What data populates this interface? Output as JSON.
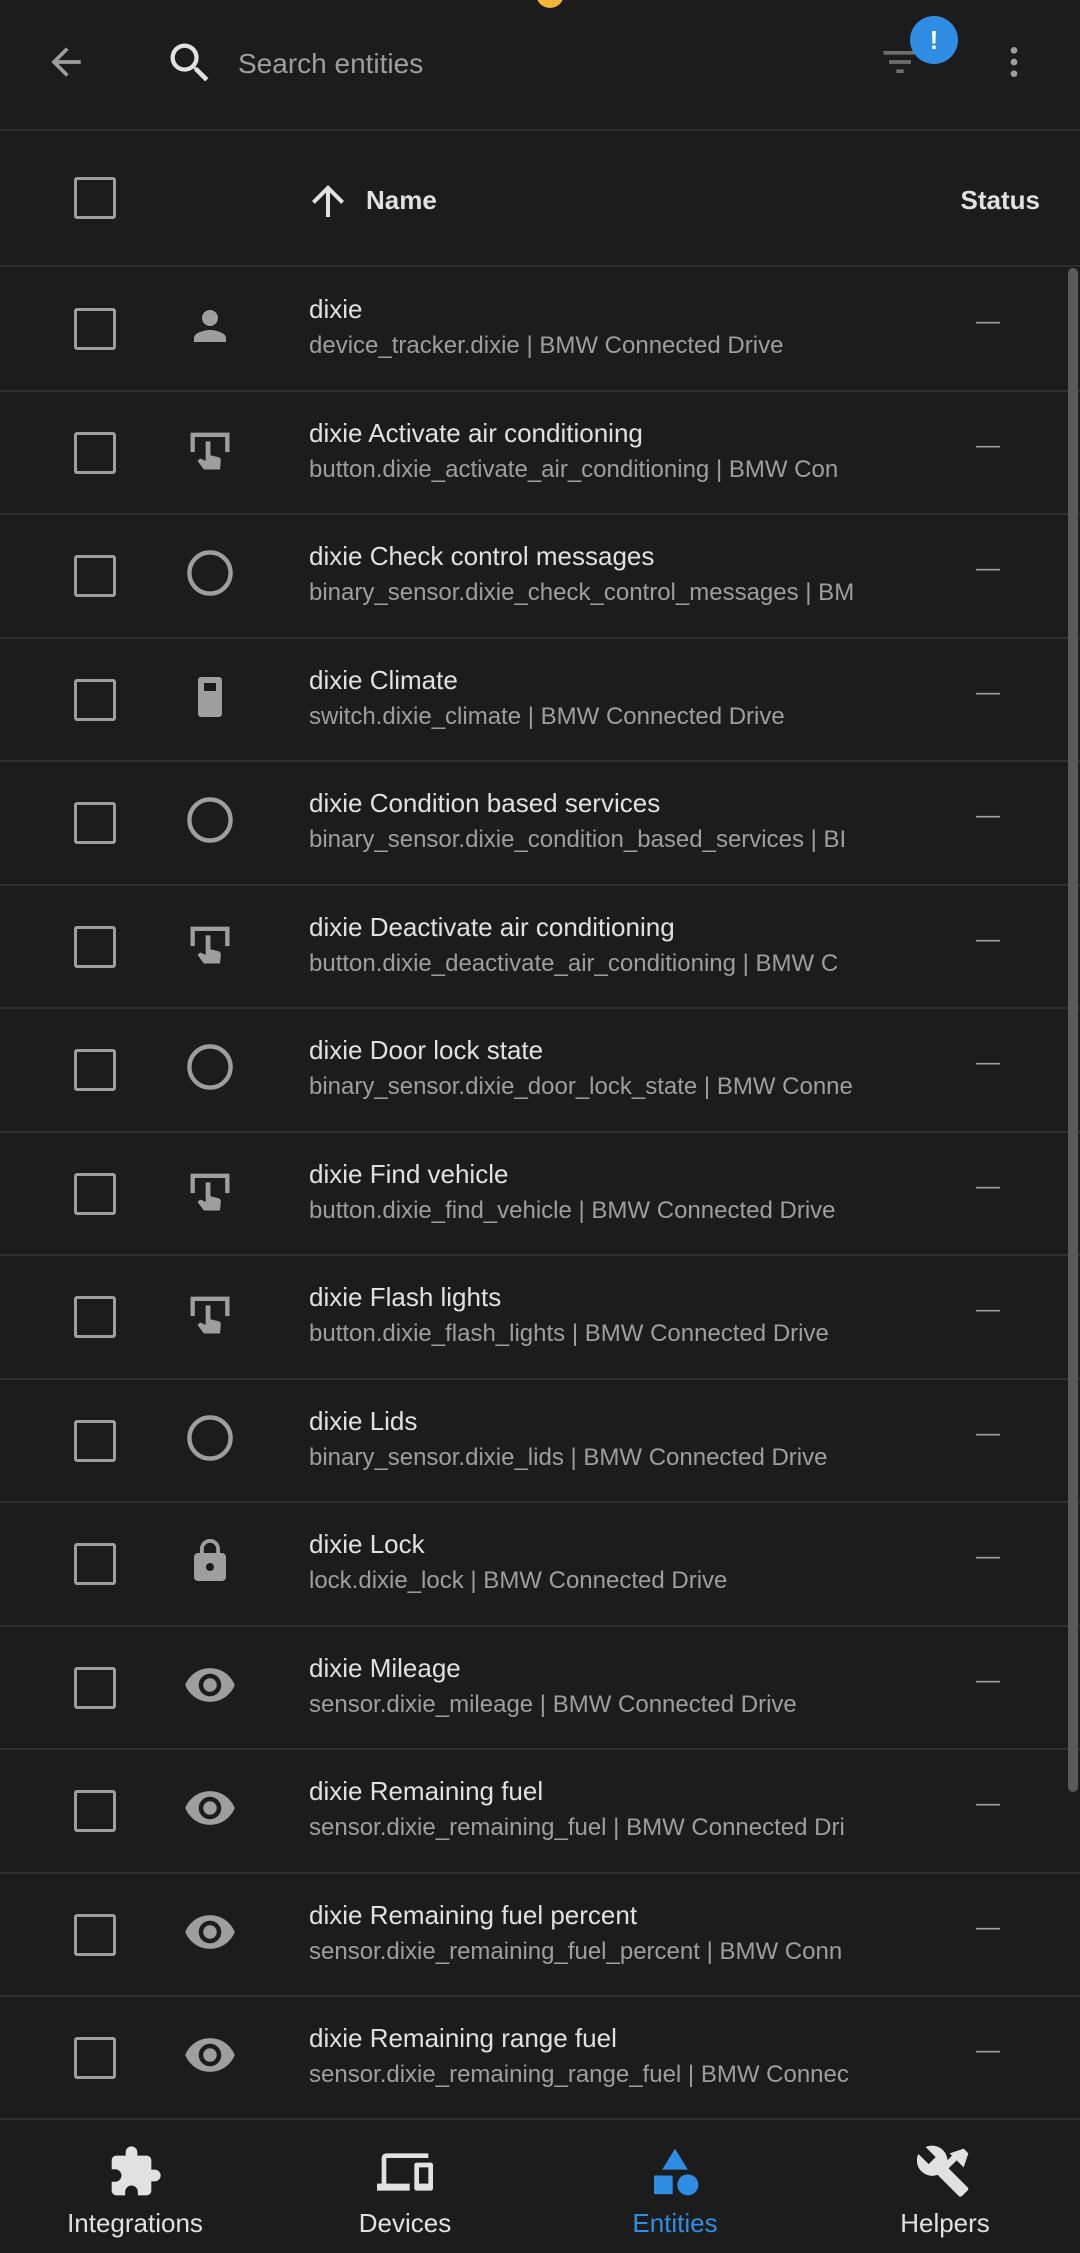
{
  "topbar": {
    "search_placeholder": "Search entities",
    "filter_badge": "!"
  },
  "table": {
    "col_name": "Name",
    "col_status": "Status"
  },
  "rows": [
    {
      "icon": "person-icon",
      "title": "dixie",
      "sub": "device_tracker.dixie | BMW Connected Drive",
      "status": "—"
    },
    {
      "icon": "gesture-tap-button-icon",
      "title": "dixie Activate air conditioning",
      "sub": "button.dixie_activate_air_conditioning | BMW Con",
      "status": "—"
    },
    {
      "icon": "circle-outline-icon",
      "title": "dixie Check control messages",
      "sub": "binary_sensor.dixie_check_control_messages | BM",
      "status": "—"
    },
    {
      "icon": "switch-icon",
      "title": "dixie Climate",
      "sub": "switch.dixie_climate | BMW Connected Drive",
      "status": "—"
    },
    {
      "icon": "circle-outline-icon",
      "title": "dixie Condition based services",
      "sub": "binary_sensor.dixie_condition_based_services | BI",
      "status": "—"
    },
    {
      "icon": "gesture-tap-button-icon",
      "title": "dixie Deactivate air conditioning",
      "sub": "button.dixie_deactivate_air_conditioning | BMW C",
      "status": "—"
    },
    {
      "icon": "circle-outline-icon",
      "title": "dixie Door lock state",
      "sub": "binary_sensor.dixie_door_lock_state | BMW Conne",
      "status": "—"
    },
    {
      "icon": "gesture-tap-button-icon",
      "title": "dixie Find vehicle",
      "sub": "button.dixie_find_vehicle | BMW Connected Drive",
      "status": "—"
    },
    {
      "icon": "gesture-tap-button-icon",
      "title": "dixie Flash lights",
      "sub": "button.dixie_flash_lights | BMW Connected Drive",
      "status": "—"
    },
    {
      "icon": "circle-outline-icon",
      "title": "dixie Lids",
      "sub": "binary_sensor.dixie_lids | BMW Connected Drive",
      "status": "—"
    },
    {
      "icon": "lock-icon",
      "title": "dixie Lock",
      "sub": "lock.dixie_lock | BMW Connected Drive",
      "status": "—"
    },
    {
      "icon": "eye-icon",
      "title": "dixie Mileage",
      "sub": "sensor.dixie_mileage | BMW Connected Drive",
      "status": "—"
    },
    {
      "icon": "eye-icon",
      "title": "dixie Remaining fuel",
      "sub": "sensor.dixie_remaining_fuel | BMW Connected Dri",
      "status": "—"
    },
    {
      "icon": "eye-icon",
      "title": "dixie Remaining fuel percent",
      "sub": "sensor.dixie_remaining_fuel_percent | BMW Conn",
      "status": "—"
    },
    {
      "icon": "eye-icon",
      "title": "dixie Remaining range fuel",
      "sub": "sensor.dixie_remaining_range_fuel | BMW Connec",
      "status": "—"
    }
  ],
  "nav": [
    {
      "icon": "puzzle-icon",
      "label": "Integrations",
      "active": false
    },
    {
      "icon": "devices-icon",
      "label": "Devices",
      "active": false
    },
    {
      "icon": "shapes-icon",
      "label": "Entities",
      "active": true
    },
    {
      "icon": "tools-icon",
      "label": "Helpers",
      "active": false
    }
  ],
  "colors": {
    "background": "#1c1c1c",
    "accent": "#2f8de4",
    "text": "#e1e1e1",
    "secondary_text": "#9e9e9e",
    "divider": "#2f2f2f"
  }
}
